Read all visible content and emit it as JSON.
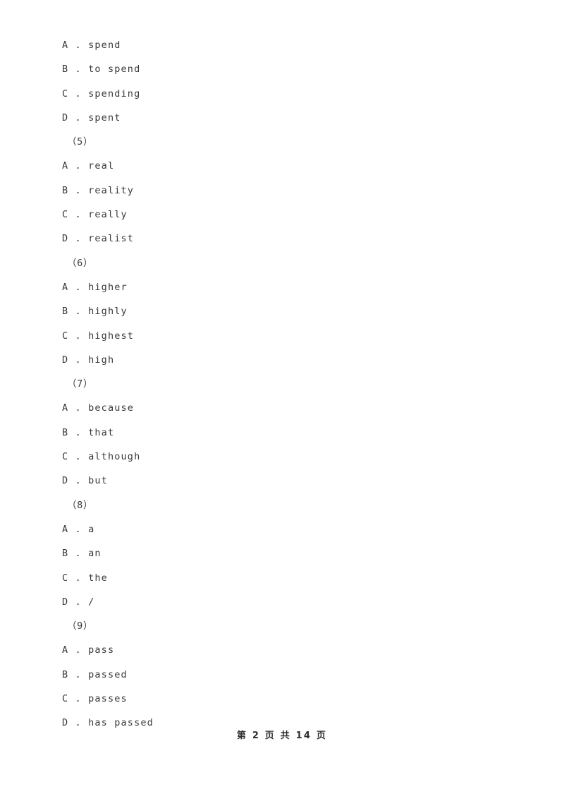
{
  "document": {
    "background_color": "#ffffff",
    "text_color": "#3a3a3a",
    "footer_color": "#2e2e2e"
  },
  "lines": [
    {
      "kind": "option",
      "letter": "A",
      "sep": " . ",
      "text": "spend"
    },
    {
      "kind": "option",
      "letter": "B",
      "sep": " . ",
      "text": "to spend"
    },
    {
      "kind": "option",
      "letter": "C",
      "sep": " . ",
      "text": "spending"
    },
    {
      "kind": "option",
      "letter": "D",
      "sep": " . ",
      "text": "spent"
    },
    {
      "kind": "qnum",
      "text": "（5）"
    },
    {
      "kind": "option",
      "letter": "A",
      "sep": " . ",
      "text": "real"
    },
    {
      "kind": "option",
      "letter": "B",
      "sep": " . ",
      "text": "reality"
    },
    {
      "kind": "option",
      "letter": "C",
      "sep": " . ",
      "text": "really"
    },
    {
      "kind": "option",
      "letter": "D",
      "sep": " . ",
      "text": "realist"
    },
    {
      "kind": "qnum",
      "text": "（6）"
    },
    {
      "kind": "option",
      "letter": "A",
      "sep": " . ",
      "text": "higher"
    },
    {
      "kind": "option",
      "letter": "B",
      "sep": " . ",
      "text": "highly"
    },
    {
      "kind": "option",
      "letter": "C",
      "sep": " . ",
      "text": "highest"
    },
    {
      "kind": "option",
      "letter": "D",
      "sep": " . ",
      "text": "high"
    },
    {
      "kind": "qnum",
      "text": "（7）"
    },
    {
      "kind": "option",
      "letter": "A",
      "sep": " . ",
      "text": "because"
    },
    {
      "kind": "option",
      "letter": "B",
      "sep": " . ",
      "text": "that"
    },
    {
      "kind": "option",
      "letter": "C",
      "sep": " . ",
      "text": "although"
    },
    {
      "kind": "option",
      "letter": "D",
      "sep": " . ",
      "text": "but"
    },
    {
      "kind": "qnum",
      "text": "（8）"
    },
    {
      "kind": "option",
      "letter": "A",
      "sep": " . ",
      "text": "a"
    },
    {
      "kind": "option",
      "letter": "B",
      "sep": " . ",
      "text": "an"
    },
    {
      "kind": "option",
      "letter": "C",
      "sep": " . ",
      "text": "the"
    },
    {
      "kind": "option",
      "letter": "D",
      "sep": " . ",
      "text": "/"
    },
    {
      "kind": "qnum",
      "text": "（9）"
    },
    {
      "kind": "option",
      "letter": "A",
      "sep": " . ",
      "text": "pass"
    },
    {
      "kind": "option",
      "letter": "B",
      "sep": " . ",
      "text": "passed"
    },
    {
      "kind": "option",
      "letter": "C",
      "sep": " . ",
      "text": "passes"
    },
    {
      "kind": "option",
      "letter": "D",
      "sep": " . ",
      "text": "has passed"
    }
  ],
  "footer": {
    "text": "第 2 页 共 14 页",
    "current_page": "2",
    "total_pages": "14"
  }
}
